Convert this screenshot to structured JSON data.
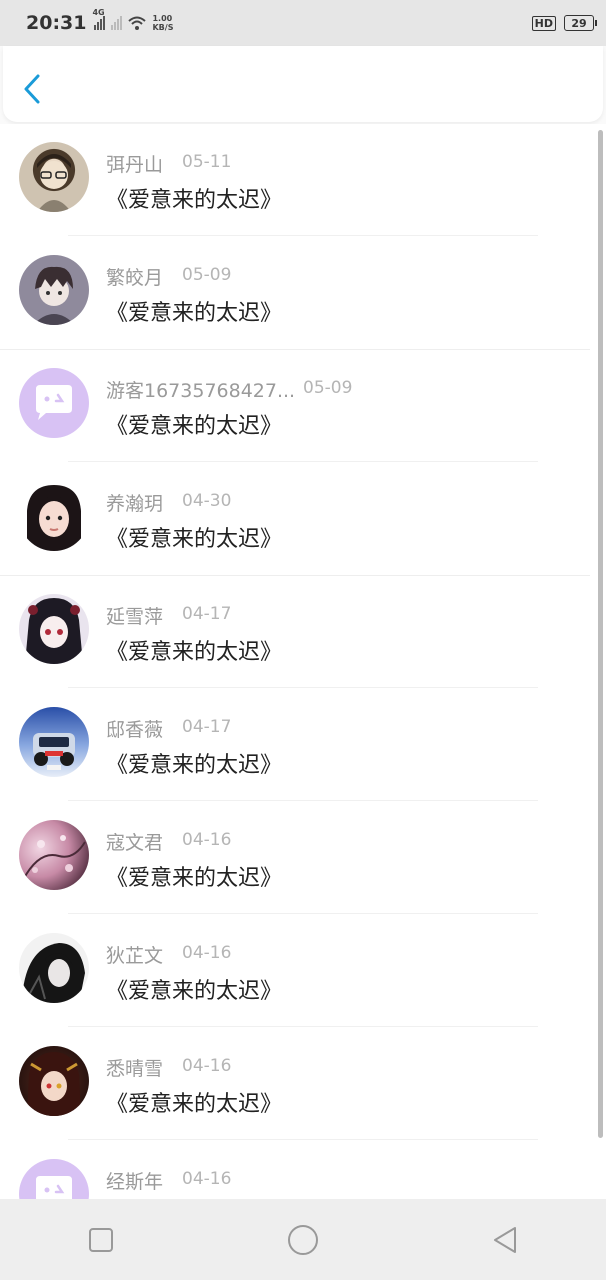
{
  "status_bar": {
    "time": "20:31",
    "network_tag": "4G",
    "speed_value": "1.00",
    "speed_unit": "KB/S",
    "hd_label": "HD",
    "battery": "29"
  },
  "header": {
    "back_icon": "chevron-left-icon",
    "accent_color": "#1a9bd8"
  },
  "comments": [
    {
      "name": "弭丹山",
      "date": "05-11",
      "title": "《爱意来的太迟》",
      "avatar": "photo"
    },
    {
      "name": "繁皎月",
      "date": "05-09",
      "title": "《爱意来的太迟》",
      "avatar": "photo"
    },
    {
      "name": "游客16735768427...",
      "date": "05-09",
      "title": "《爱意来的太迟》",
      "avatar": "default"
    },
    {
      "name": "养瀚玥",
      "date": "04-30",
      "title": "《爱意来的太迟》",
      "avatar": "photo"
    },
    {
      "name": "延雪萍",
      "date": "04-17",
      "title": "《爱意来的太迟》",
      "avatar": "photo"
    },
    {
      "name": "邸香薇",
      "date": "04-17",
      "title": "《爱意来的太迟》",
      "avatar": "photo"
    },
    {
      "name": "寇文君",
      "date": "04-16",
      "title": "《爱意来的太迟》",
      "avatar": "photo"
    },
    {
      "name": "狄芷文",
      "date": "04-16",
      "title": "《爱意来的太迟》",
      "avatar": "photo"
    },
    {
      "name": "悉晴雪",
      "date": "04-16",
      "title": "《爱意来的太迟》",
      "avatar": "photo"
    },
    {
      "name": "经斯年",
      "date": "04-16",
      "title": "",
      "avatar": "default"
    }
  ],
  "nav_bar": {
    "recents_icon": "square-icon",
    "home_icon": "circle-icon",
    "back_icon": "triangle-back-icon"
  }
}
